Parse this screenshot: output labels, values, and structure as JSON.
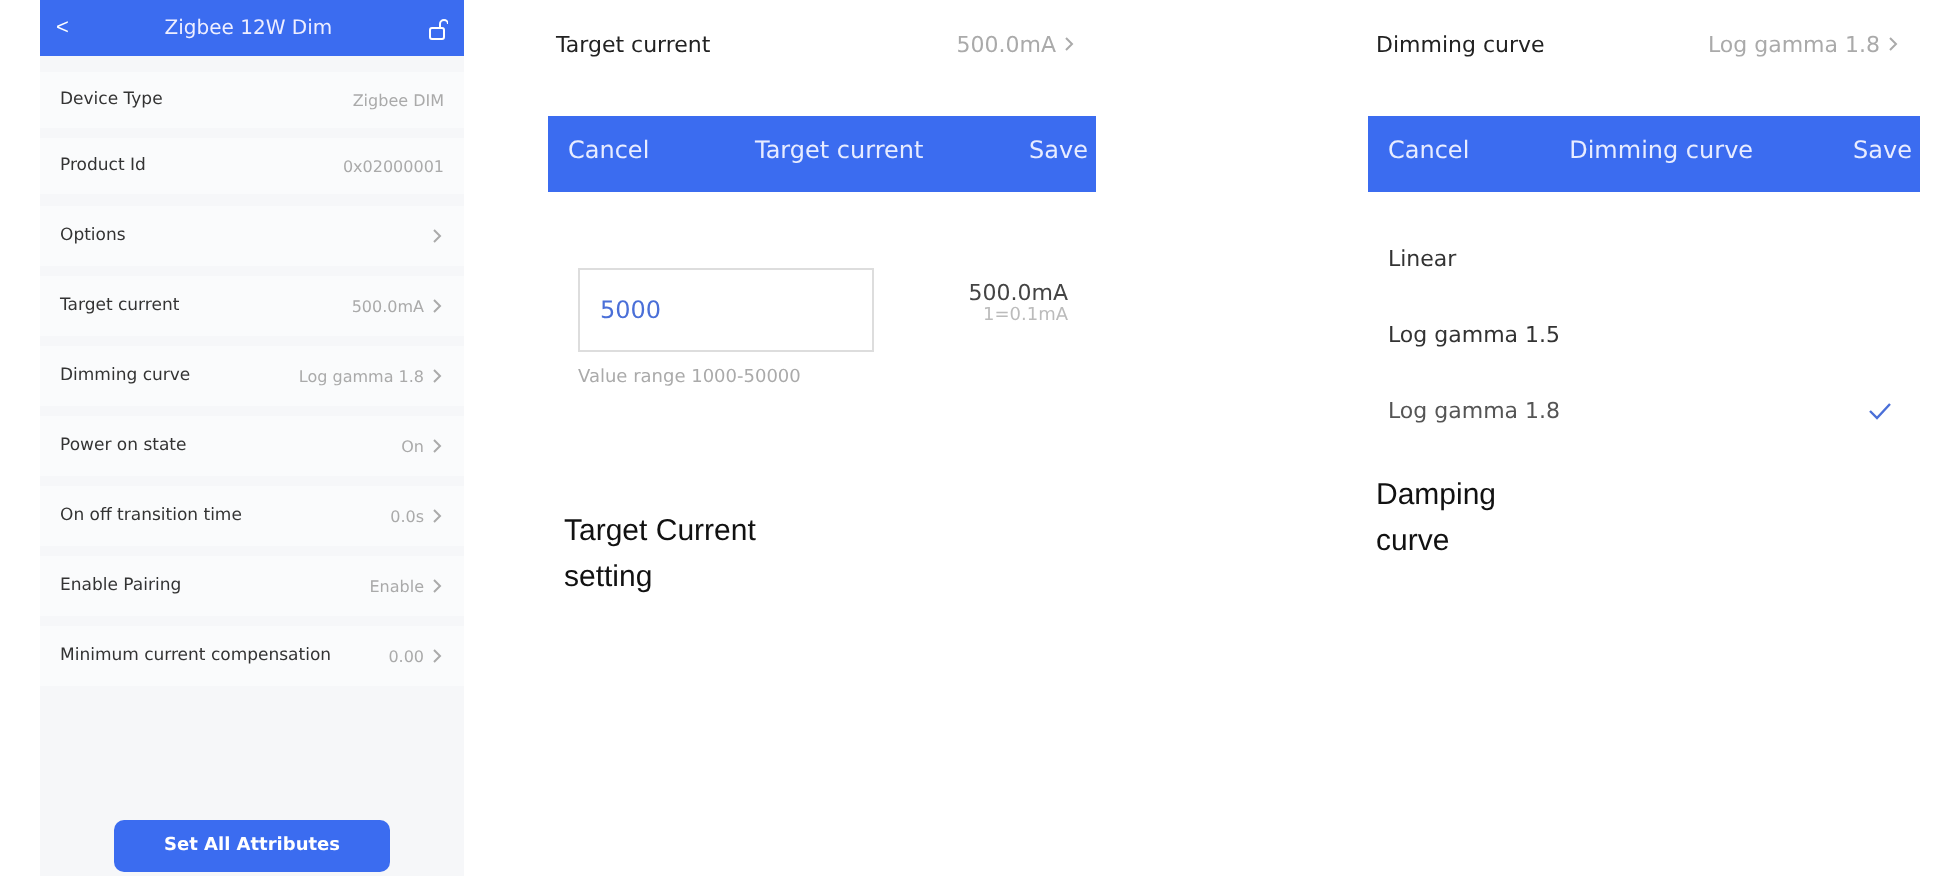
{
  "device_screen": {
    "title": "Zigbee 12W Dim",
    "back": "<",
    "rows": [
      {
        "kind": "info",
        "label": "Device Type",
        "value": "Zigbee DIM"
      },
      {
        "kind": "info",
        "label": "Product Id",
        "value": "0x02000001"
      },
      {
        "kind": "nav",
        "label": "Options",
        "value": ""
      },
      {
        "kind": "nav",
        "label": "Target current",
        "value": "500.0mA"
      },
      {
        "kind": "nav",
        "label": "Dimming curve",
        "value": "Log gamma 1.8"
      },
      {
        "kind": "nav",
        "label": "Power on state",
        "value": "On"
      },
      {
        "kind": "nav",
        "label": "On off transition time",
        "value": "0.0s"
      },
      {
        "kind": "nav",
        "label": "Enable Pairing",
        "value": "Enable"
      },
      {
        "kind": "nav",
        "label": "Minimum current compensation",
        "value": "0.00"
      }
    ],
    "button": "Set All Attributes"
  },
  "current_dialog": {
    "row": {
      "label": "Target current",
      "value": "500.0mA"
    },
    "cancel": "Cancel",
    "title": "Target current",
    "save": "Save",
    "input": {
      "value": "5000"
    },
    "reading": "500.0mA",
    "unit_note": "1=0.1mA",
    "range": "Value range 1000-50000",
    "caption": "Target Current setting"
  },
  "curve_dialog": {
    "row": {
      "label": "Dimming curve",
      "value": "Log gamma 1.8"
    },
    "cancel": "Cancel",
    "title": "Dimming curve",
    "save": "Save",
    "options": [
      {
        "label": "Linear",
        "selected": false
      },
      {
        "label": "Log gamma 1.5",
        "selected": false
      },
      {
        "label": "Log gamma 1.8",
        "selected": true
      }
    ],
    "caption": "Damping curve"
  }
}
